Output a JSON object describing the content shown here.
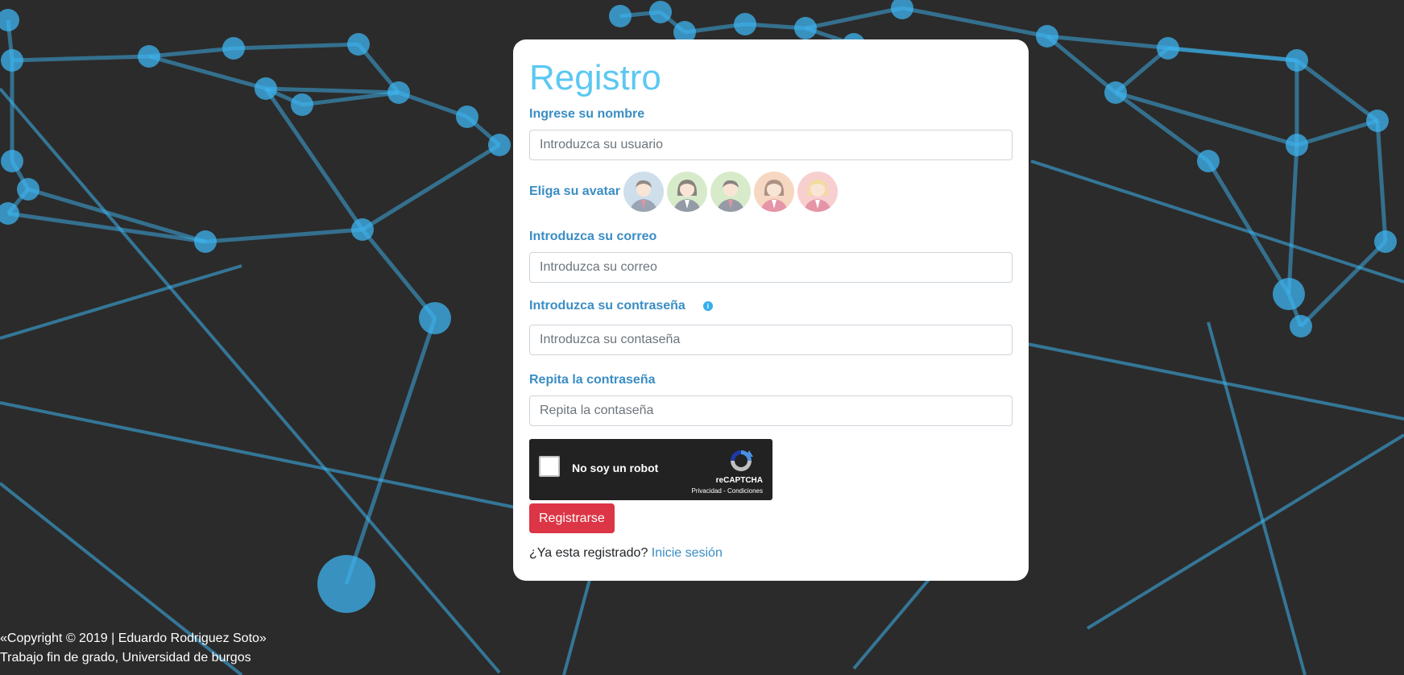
{
  "form": {
    "title": "Registro",
    "name_label": "Ingrese su nombre",
    "name_placeholder": "Introduzca su usuario",
    "avatar_label": "Eliga su avatar",
    "avatars": [
      {
        "icon": "male-avatar-icon",
        "bg": "#a9c4dc",
        "shirt": "#4a5a78",
        "tie": "#c0405a",
        "hair": "#3a2a20"
      },
      {
        "icon": "female-avatar-icon",
        "bg": "#b8dca0",
        "shirt": "#3e4a5e",
        "tie": "#ffffff",
        "hair": "#2a1e18"
      },
      {
        "icon": "male-avatar-icon",
        "bg": "#b8dca0",
        "shirt": "#3e4a5e",
        "tie": "#c0405a",
        "hair": "#2a1e18"
      },
      {
        "icon": "female-avatar-icon",
        "bg": "#f0b890",
        "shirt": "#d04060",
        "tie": "#ffffff",
        "hair": "#6a3a20"
      },
      {
        "icon": "female-avatar-icon",
        "bg": "#f4a8a8",
        "shirt": "#d04060",
        "tie": "#ffffff",
        "hair": "#e8c050"
      }
    ],
    "email_label": "Introduzca su correo",
    "email_placeholder": "Introduzca su correo",
    "password_label": "Introduzca su contraseña",
    "password_placeholder": "Introduzca su contaseña",
    "repeat_label": "Repita la contraseña",
    "repeat_placeholder": "Repita la contaseña",
    "submit_label": "Registrarse",
    "login_prompt": "¿Ya esta registrado?",
    "login_link": "Inicie sesión"
  },
  "captcha": {
    "label": "No soy un robot",
    "brand": "reCAPTCHA",
    "links": "Privacidad - Condiciones"
  },
  "footer": {
    "line1": "«Copyright © 2019 | Eduardo Rodriguez Soto»",
    "line2": "Trabajo fin de grado, Universidad de burgos"
  },
  "colors": {
    "accent": "#5bc8f2",
    "label": "#3a8dc4",
    "submit": "#dc3545",
    "network": "#3db4f0"
  }
}
